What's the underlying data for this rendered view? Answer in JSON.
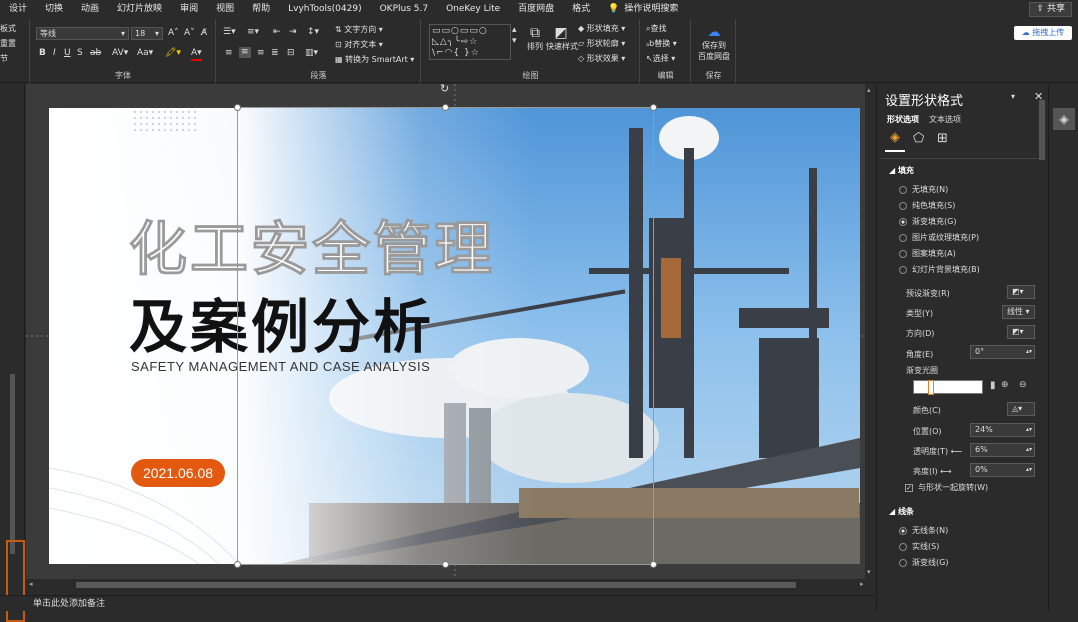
{
  "menubar": {
    "tabs": [
      "设计",
      "切换",
      "动画",
      "幻灯片放映",
      "审阅",
      "视图",
      "帮助",
      "LvyhTools(0429)",
      "OKPlus 5.7",
      "OneKey Lite",
      "百度网盘",
      "格式"
    ],
    "search_label": "操作说明搜索",
    "share_label": "共享"
  },
  "ribbon": {
    "left_cut": [
      "板式",
      "重置",
      "节"
    ],
    "font_name": "等线",
    "font_size": "18",
    "font_group_label": "字体",
    "para_group_label": "段落",
    "text_direction": "文字方向",
    "align_text": "对齐文本",
    "convert_smartart": "转换为 SmartArt",
    "draw_group_label": "绘图",
    "arrange": "排列",
    "quick_styles": "快速样式",
    "shape_fill": "形状填充",
    "shape_outline": "形状轮廓",
    "shape_effects": "形状效果",
    "find": "查找",
    "replace": "替换",
    "select": "选择",
    "edit_group_label": "编辑",
    "save_baidu_1": "保存到",
    "save_baidu_2": "百度网盘",
    "save_group_label": "保存",
    "cloud_upload": "拖拽上传"
  },
  "slide": {
    "title_outline": "化工安全管理",
    "title_main": "及案例分析",
    "subtitle": "SAFETY MANAGEMENT AND CASE ANALYSIS",
    "date": "2021.06.08"
  },
  "notes_placeholder": "单击此处添加备注",
  "format_panel": {
    "title": "设置形状格式",
    "tab_shape": "形状选项",
    "tab_text": "文本选项",
    "fill_header": "填充",
    "fill_options": [
      "无填充(N)",
      "纯色填充(S)",
      "渐变填充(G)",
      "图片或纹理填充(P)",
      "图案填充(A)",
      "幻灯片背景填充(B)"
    ],
    "selected_fill": "渐变填充(G)",
    "preset_gradient": "预设渐变(R)",
    "type_label": "类型(Y)",
    "type_value": "线性",
    "direction_label": "方向(D)",
    "angle_label": "角度(E)",
    "angle_value": "0°",
    "stops_label": "渐变光圈",
    "color_label": "颜色(C)",
    "position_label": "位置(O)",
    "position_value": "24%",
    "transparency_label": "透明度(T)",
    "transparency_value": "6%",
    "brightness_label": "亮度(I)",
    "brightness_value": "0%",
    "rotate_with_shape": "与形状一起旋转(W)",
    "line_header": "线条",
    "line_options": [
      "无线条(N)",
      "实线(S)",
      "渐变线(G)"
    ],
    "selected_line": "无线条(N)"
  },
  "colors": {
    "accent_orange": "#e2590f",
    "sky": "#6aa8df"
  }
}
